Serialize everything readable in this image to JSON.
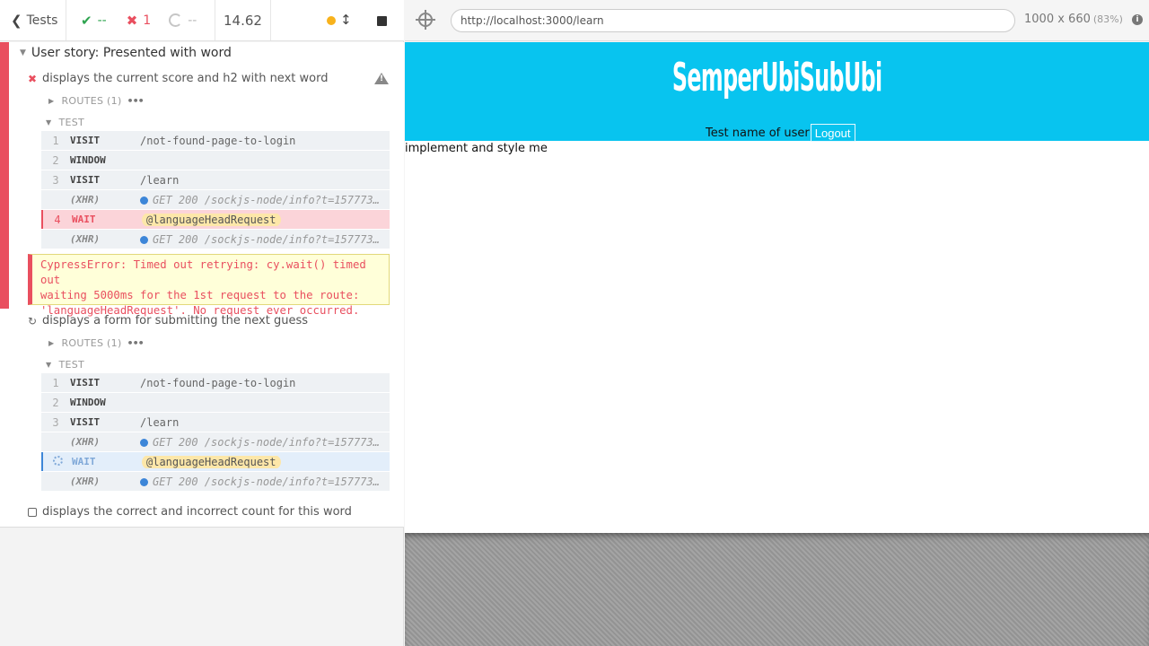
{
  "header": {
    "tests_label": "Tests",
    "passed": "--",
    "failed": "1",
    "pending": "--",
    "duration": "14.62"
  },
  "suite": {
    "title": "User story: Presented with word",
    "tests": [
      {
        "title": "displays the current score and h2 with next word",
        "state": "failed",
        "routes_label": "ROUTES (1)",
        "test_label": "TEST",
        "commands": [
          {
            "num": "1",
            "name": "VISIT",
            "message": "/not-found-page-to-login"
          },
          {
            "num": "2",
            "name": "WINDOW",
            "message": ""
          },
          {
            "num": "3",
            "name": "VISIT",
            "message": "/learn"
          },
          {
            "num": "",
            "name": "(XHR)",
            "message": "GET 200 /sockjs-node/info?t=1577731..."
          },
          {
            "num": "4",
            "name": "WAIT",
            "message": "@languageHeadRequest",
            "state": "failed"
          },
          {
            "num": "",
            "name": "(XHR)",
            "message": "GET 200 /sockjs-node/info?t=1577731..."
          }
        ],
        "error": "CypressError: Timed out retrying: cy.wait() timed out waiting 5000ms for the 1st request to the route: 'languageHeadRequest'. No request ever occurred.",
        "error_lines": [
          "CypressError: Timed out retrying: cy.wait() timed out",
          "waiting 5000ms for the 1st request to the route:",
          "'languageHeadRequest'. No request ever occurred."
        ]
      },
      {
        "title": "displays a form for submitting the next guess",
        "state": "running",
        "routes_label": "ROUTES (1)",
        "test_label": "TEST",
        "commands": [
          {
            "num": "1",
            "name": "VISIT",
            "message": "/not-found-page-to-login"
          },
          {
            "num": "2",
            "name": "WINDOW",
            "message": ""
          },
          {
            "num": "3",
            "name": "VISIT",
            "message": "/learn"
          },
          {
            "num": "",
            "name": "(XHR)",
            "message": "GET 200 /sockjs-node/info?t=1577731..."
          },
          {
            "num": "",
            "name": "WAIT",
            "message": "@languageHeadRequest",
            "state": "pending"
          },
          {
            "num": "",
            "name": "(XHR)",
            "message": "GET 200 /sockjs-node/info?t=1577731..."
          }
        ]
      },
      {
        "title": "displays the correct and incorrect count for this word",
        "state": "queued"
      }
    ]
  },
  "aut": {
    "url": "http://localhost:3000/learn",
    "viewport": "1000 x 660",
    "scale": "(83%)",
    "app": {
      "logo_words": [
        "Semper",
        "Ubi",
        "Sub",
        "Ubi"
      ],
      "user_name": "Test name of user",
      "logout_label": "Logout",
      "body_text": "implement and style me",
      "banner_color": "#08c4ef"
    }
  },
  "colors": {
    "failed": "#e94f5f",
    "passed": "#2ea44f",
    "pending_blue": "#3d86d8",
    "alias_bg": "#fde7a9"
  }
}
